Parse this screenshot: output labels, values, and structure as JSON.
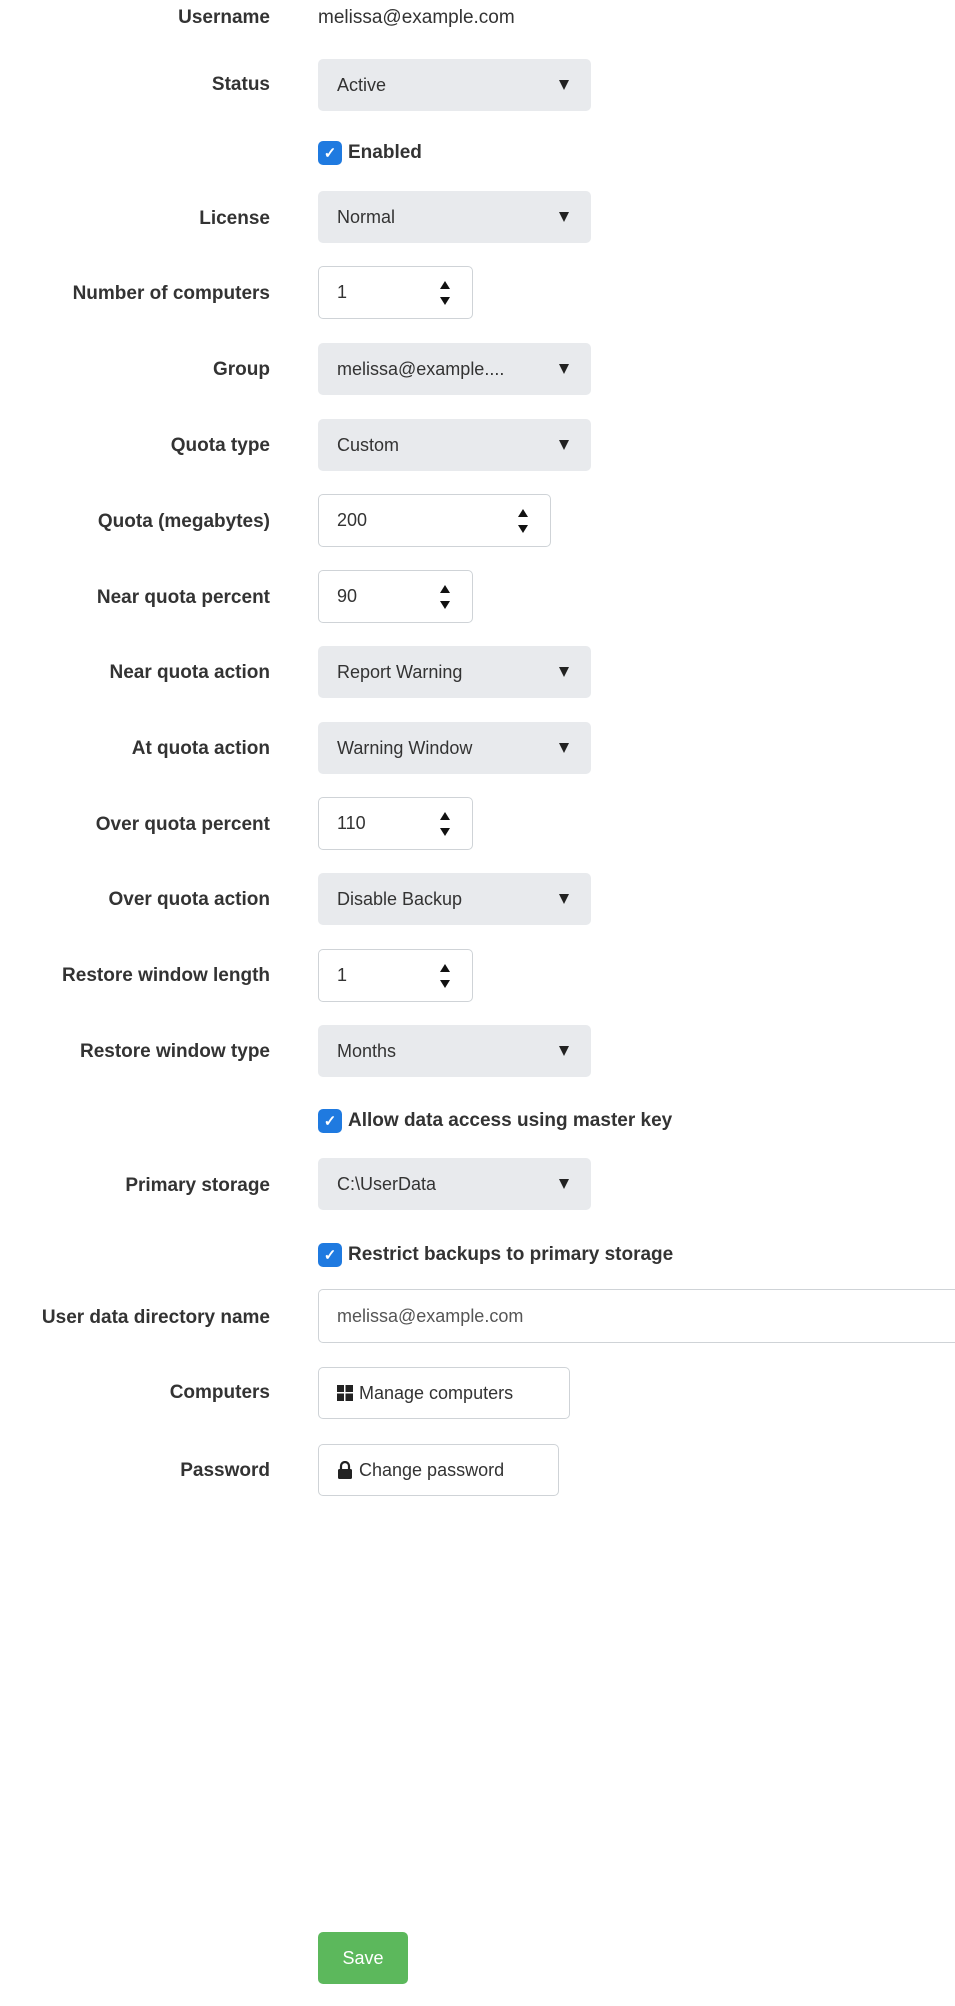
{
  "form": {
    "username": {
      "label": "Username",
      "value": "melissa@example.com"
    },
    "status": {
      "label": "Status",
      "value": "Active"
    },
    "enabled": {
      "label": "Enabled",
      "checked": true
    },
    "license": {
      "label": "License",
      "value": "Normal"
    },
    "num_computers": {
      "label": "Number of computers",
      "value": "1"
    },
    "group": {
      "label": "Group",
      "value": "melissa@example...."
    },
    "quota_type": {
      "label": "Quota type",
      "value": "Custom"
    },
    "quota_mb": {
      "label": "Quota (megabytes)",
      "value": "200"
    },
    "near_quota_percent": {
      "label": "Near quota percent",
      "value": "90"
    },
    "near_quota_action": {
      "label": "Near quota action",
      "value": "Report Warning"
    },
    "at_quota_action": {
      "label": "At quota action",
      "value": "Warning Window"
    },
    "over_quota_percent": {
      "label": "Over quota percent",
      "value": "110"
    },
    "over_quota_action": {
      "label": "Over quota action",
      "value": "Disable Backup"
    },
    "restore_window_length": {
      "label": "Restore window length",
      "value": "1"
    },
    "restore_window_type": {
      "label": "Restore window type",
      "value": "Months"
    },
    "allow_master_key": {
      "label": "Allow data access using master key",
      "checked": true
    },
    "primary_storage": {
      "label": "Primary storage",
      "value": "C:\\UserData"
    },
    "restrict_backups": {
      "label": "Restrict backups to primary storage",
      "checked": true
    },
    "user_data_dir": {
      "label": "User data directory name",
      "value": "melissa@example.com"
    },
    "computers": {
      "label": "Computers",
      "button": "Manage computers",
      "icon": "windows-icon"
    },
    "password": {
      "label": "Password",
      "button": "Change password",
      "icon": "lock-icon"
    },
    "save_label": "Save"
  },
  "colors": {
    "select_bg": "#e8eaed",
    "checkbox": "#1f7ae0",
    "save_button": "#5cb85c",
    "label_text": "#333333"
  }
}
